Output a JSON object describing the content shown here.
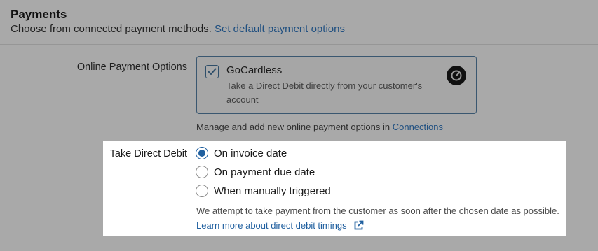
{
  "header": {
    "title": "Payments",
    "subtitle": "Choose from connected payment methods.",
    "default_link": "Set default payment options"
  },
  "online_options": {
    "label": "Online Payment Options",
    "card": {
      "name": "GoCardless",
      "description": "Take a Direct Debit directly from your customer's account",
      "checked": true
    },
    "manage_text": "Manage and add new online payment options in",
    "manage_link": "Connections"
  },
  "direct_debit": {
    "label": "Take Direct Debit",
    "options": [
      {
        "label": "On invoice date",
        "selected": true
      },
      {
        "label": "On payment due date",
        "selected": false
      },
      {
        "label": "When manually triggered",
        "selected": false
      }
    ],
    "note": "We attempt to take payment from the customer as soon after the chosen date as possible.",
    "learn_link": "Learn more about direct debit timings"
  },
  "colors": {
    "overlay_gray": "#a9a9a9",
    "link_blue": "#1f5f9f",
    "card_border": "#3a5770"
  },
  "icons": {
    "checkbox": "checkmark-icon",
    "provider_logo": "gocardless-logo-icon",
    "external_link": "external-link-icon"
  }
}
